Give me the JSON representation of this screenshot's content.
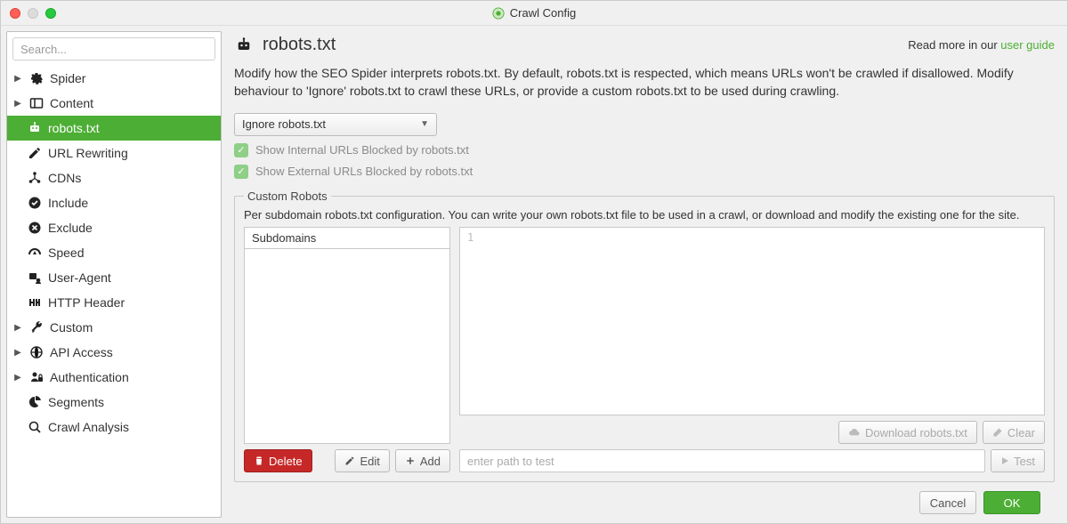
{
  "window": {
    "title": "Crawl Config"
  },
  "search": {
    "placeholder": "Search..."
  },
  "sidebar": {
    "items": [
      {
        "label": "Spider",
        "icon": "gear"
      },
      {
        "label": "Content",
        "icon": "panel"
      },
      {
        "label": "robots.txt",
        "icon": "robot"
      },
      {
        "label": "URL Rewriting",
        "icon": "edit"
      },
      {
        "label": "CDNs",
        "icon": "network"
      },
      {
        "label": "Include",
        "icon": "check-circle"
      },
      {
        "label": "Exclude",
        "icon": "x-circle"
      },
      {
        "label": "Speed",
        "icon": "gauge"
      },
      {
        "label": "User-Agent",
        "icon": "user-agent"
      },
      {
        "label": "HTTP Header",
        "icon": "http"
      },
      {
        "label": "Custom",
        "icon": "wrench"
      },
      {
        "label": "API Access",
        "icon": "globe"
      },
      {
        "label": "Authentication",
        "icon": "lock-user"
      },
      {
        "label": "Segments",
        "icon": "pie"
      },
      {
        "label": "Crawl Analysis",
        "icon": "search"
      }
    ]
  },
  "page": {
    "title": "robots.txt",
    "readmore_prefix": "Read more in our ",
    "readmore_link": "user guide",
    "description": "Modify how the SEO Spider interprets robots.txt. By default, robots.txt is respected, which means URLs won't be crawled if disallowed. Modify behaviour to 'Ignore' robots.txt to crawl these URLs, or provide a custom robots.txt to be used during crawling.",
    "dropdown_value": "Ignore robots.txt",
    "check1": "Show Internal URLs Blocked by robots.txt",
    "check2": "Show External URLs Blocked by robots.txt",
    "custom_robots": {
      "legend": "Custom Robots",
      "desc": "Per subdomain robots.txt configuration. You can write your own robots.txt file to be used in a crawl, or download and modify the existing one for the site.",
      "subdomains_header": "Subdomains",
      "editor_linenum": "1",
      "download_btn": "Download robots.txt",
      "clear_btn": "Clear",
      "delete_btn": "Delete",
      "edit_btn": "Edit",
      "add_btn": "Add",
      "test_placeholder": "enter path to test",
      "test_btn": "Test"
    }
  },
  "footer": {
    "cancel": "Cancel",
    "ok": "OK"
  }
}
